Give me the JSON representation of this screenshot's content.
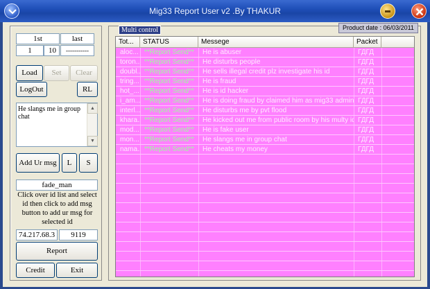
{
  "window": {
    "title": "Mig33 Report User v2 .By THAKUR"
  },
  "left": {
    "first_label": "1st",
    "last_label": "last",
    "first_value": "1",
    "last_value": "10",
    "last_dots": "-----------",
    "load": "Load",
    "set": "Set",
    "clear": "Clear",
    "logout": "LogOut",
    "rl": "RL",
    "msg_text": "He slangs me in group chat",
    "add_msg": "Add Ur msg",
    "l_btn": "L",
    "s_btn": "S",
    "username": "fade_man",
    "help_text": "Click over id list and select id then click to add msg button to add ur msg for selected id",
    "ip": "74.217.68.3",
    "port": "9119",
    "report": "Report",
    "credit": "Credit",
    "exit": "Exit"
  },
  "right": {
    "multi_label": "Multi control",
    "product_date": "Product date : 06/03/2011",
    "columns": [
      "Tot...",
      "STATUS",
      "Messege",
      "Packet"
    ],
    "rows": [
      {
        "tot": "aloc...",
        "status": "**Report Send**",
        "msg": "He is abuser",
        "packet": "ГДГД"
      },
      {
        "tot": "toron...",
        "status": "**Report Send**",
        "msg": "He disturbs people",
        "packet": "ГДГД"
      },
      {
        "tot": "doubl...",
        "status": "**Report Send**",
        "msg": "He sells illegal credit plz investigate his id",
        "packet": "ГДГД"
      },
      {
        "tot": "tring...",
        "status": "**Report Send**",
        "msg": "He is fraud",
        "packet": "ГДГД"
      },
      {
        "tot": "hot_...",
        "status": "**Report Send**",
        "msg": "He is id hacker",
        "packet": "ГДГД"
      },
      {
        "tot": "i_am...",
        "status": "**Report Send**",
        "msg": "He is doing fraud by claimed him as mig33 admin",
        "packet": "ГДГД"
      },
      {
        "tot": "interl...",
        "status": "**Report Send**",
        "msg": "He disturbs me by pvt flood",
        "packet": "ГДГД"
      },
      {
        "tot": "khara...",
        "status": "**Report Send**",
        "msg": "He kicked out me from public room by his multy ids",
        "packet": "ГДГД"
      },
      {
        "tot": "mod...",
        "status": "**Report Send**",
        "msg": "He is fake user",
        "packet": "ГДГД"
      },
      {
        "tot": "mon...",
        "status": "**Report Send**",
        "msg": "He slangs me in group chat",
        "packet": "ГДГД"
      },
      {
        "tot": "nama...",
        "status": "**Report Send**",
        "msg": "He cheats my money",
        "packet": "ГДГД"
      }
    ]
  },
  "colors": {
    "grid_bg": "#ff80ff",
    "status_green": "#9cff9c",
    "titlebar_blue": "#1f4fb8"
  },
  "icons": {
    "system": "chevron-down-circle-icon",
    "minimize": "minimize-icon",
    "close": "close-icon"
  }
}
